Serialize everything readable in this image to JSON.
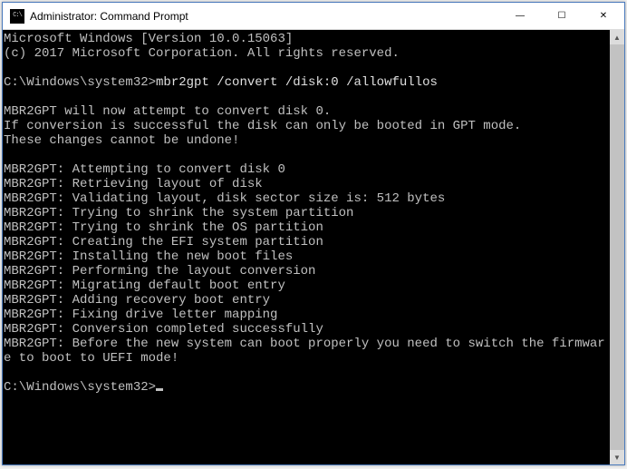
{
  "window": {
    "title": "Administrator: Command Prompt",
    "icon_label": "cmd-icon",
    "icon_text": "C:\\"
  },
  "controls": {
    "minimize": "—",
    "maximize": "☐",
    "close": "✕"
  },
  "terminal": {
    "header_line1": "Microsoft Windows [Version 10.0.15063]",
    "header_line2": "(c) 2017 Microsoft Corporation. All rights reserved.",
    "prompt1_path": "C:\\Windows\\system32>",
    "prompt1_cmd": "mbr2gpt /convert /disk:0 /allowfullos",
    "preamble": [
      "MBR2GPT will now attempt to convert disk 0.",
      "If conversion is successful the disk can only be booted in GPT mode.",
      "These changes cannot be undone!"
    ],
    "log": [
      "MBR2GPT: Attempting to convert disk 0",
      "MBR2GPT: Retrieving layout of disk",
      "MBR2GPT: Validating layout, disk sector size is: 512 bytes",
      "MBR2GPT: Trying to shrink the system partition",
      "MBR2GPT: Trying to shrink the OS partition",
      "MBR2GPT: Creating the EFI system partition",
      "MBR2GPT: Installing the new boot files",
      "MBR2GPT: Performing the layout conversion",
      "MBR2GPT: Migrating default boot entry",
      "MBR2GPT: Adding recovery boot entry",
      "MBR2GPT: Fixing drive letter mapping",
      "MBR2GPT: Conversion completed successfully",
      "MBR2GPT: Before the new system can boot properly you need to switch the firmware to boot to UEFI mode!"
    ],
    "prompt2_path": "C:\\Windows\\system32>"
  }
}
